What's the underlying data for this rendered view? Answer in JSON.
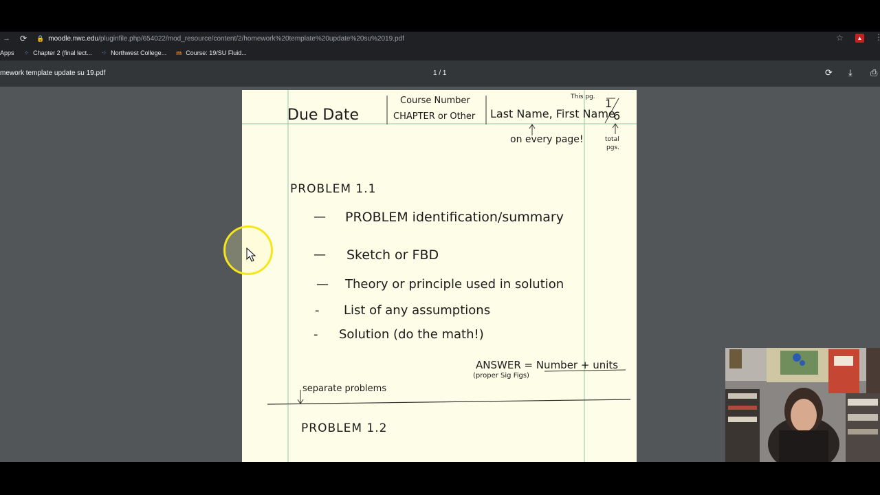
{
  "browser": {
    "url_domain": "moodle.nwc.edu",
    "url_path": "/pluginfile.php/654022/mod_resource/content/2/homework%20template%20update%20su%2019.pdf",
    "bookmarks": [
      {
        "label": "Apps"
      },
      {
        "label": "Chapter 2 (final lect..."
      },
      {
        "label": "Northwest College..."
      },
      {
        "label": "Course: 19/SU Fluid..."
      }
    ]
  },
  "pdf_toolbar": {
    "file_title": "mework template update su 19.pdf",
    "page_indicator": "1 / 1"
  },
  "document": {
    "header": {
      "due_date": "Due Date",
      "course_number": "Course Number",
      "chapter": "CHAPTER or Other",
      "name": "Last Name, First Name",
      "this_pg": "This pg.",
      "page_fraction_top": "1",
      "page_fraction_bottom": "6",
      "every_page_note": "on every page!",
      "total_pgs_1": "total",
      "total_pgs_2": "pgs."
    },
    "problem1": {
      "title": "PROBLEM 1.1",
      "items": [
        "PROBLEM identification/summary",
        "Sketch or FBD",
        "Theory or principle used in solution",
        "List of any assumptions",
        "Solution (do the math!)"
      ],
      "answer": "ANSWER = Number + units",
      "answer_note": "(proper Sig Figs)",
      "separate_note": "separate problems"
    },
    "problem2": {
      "title": "PROBLEM 1.2"
    }
  }
}
